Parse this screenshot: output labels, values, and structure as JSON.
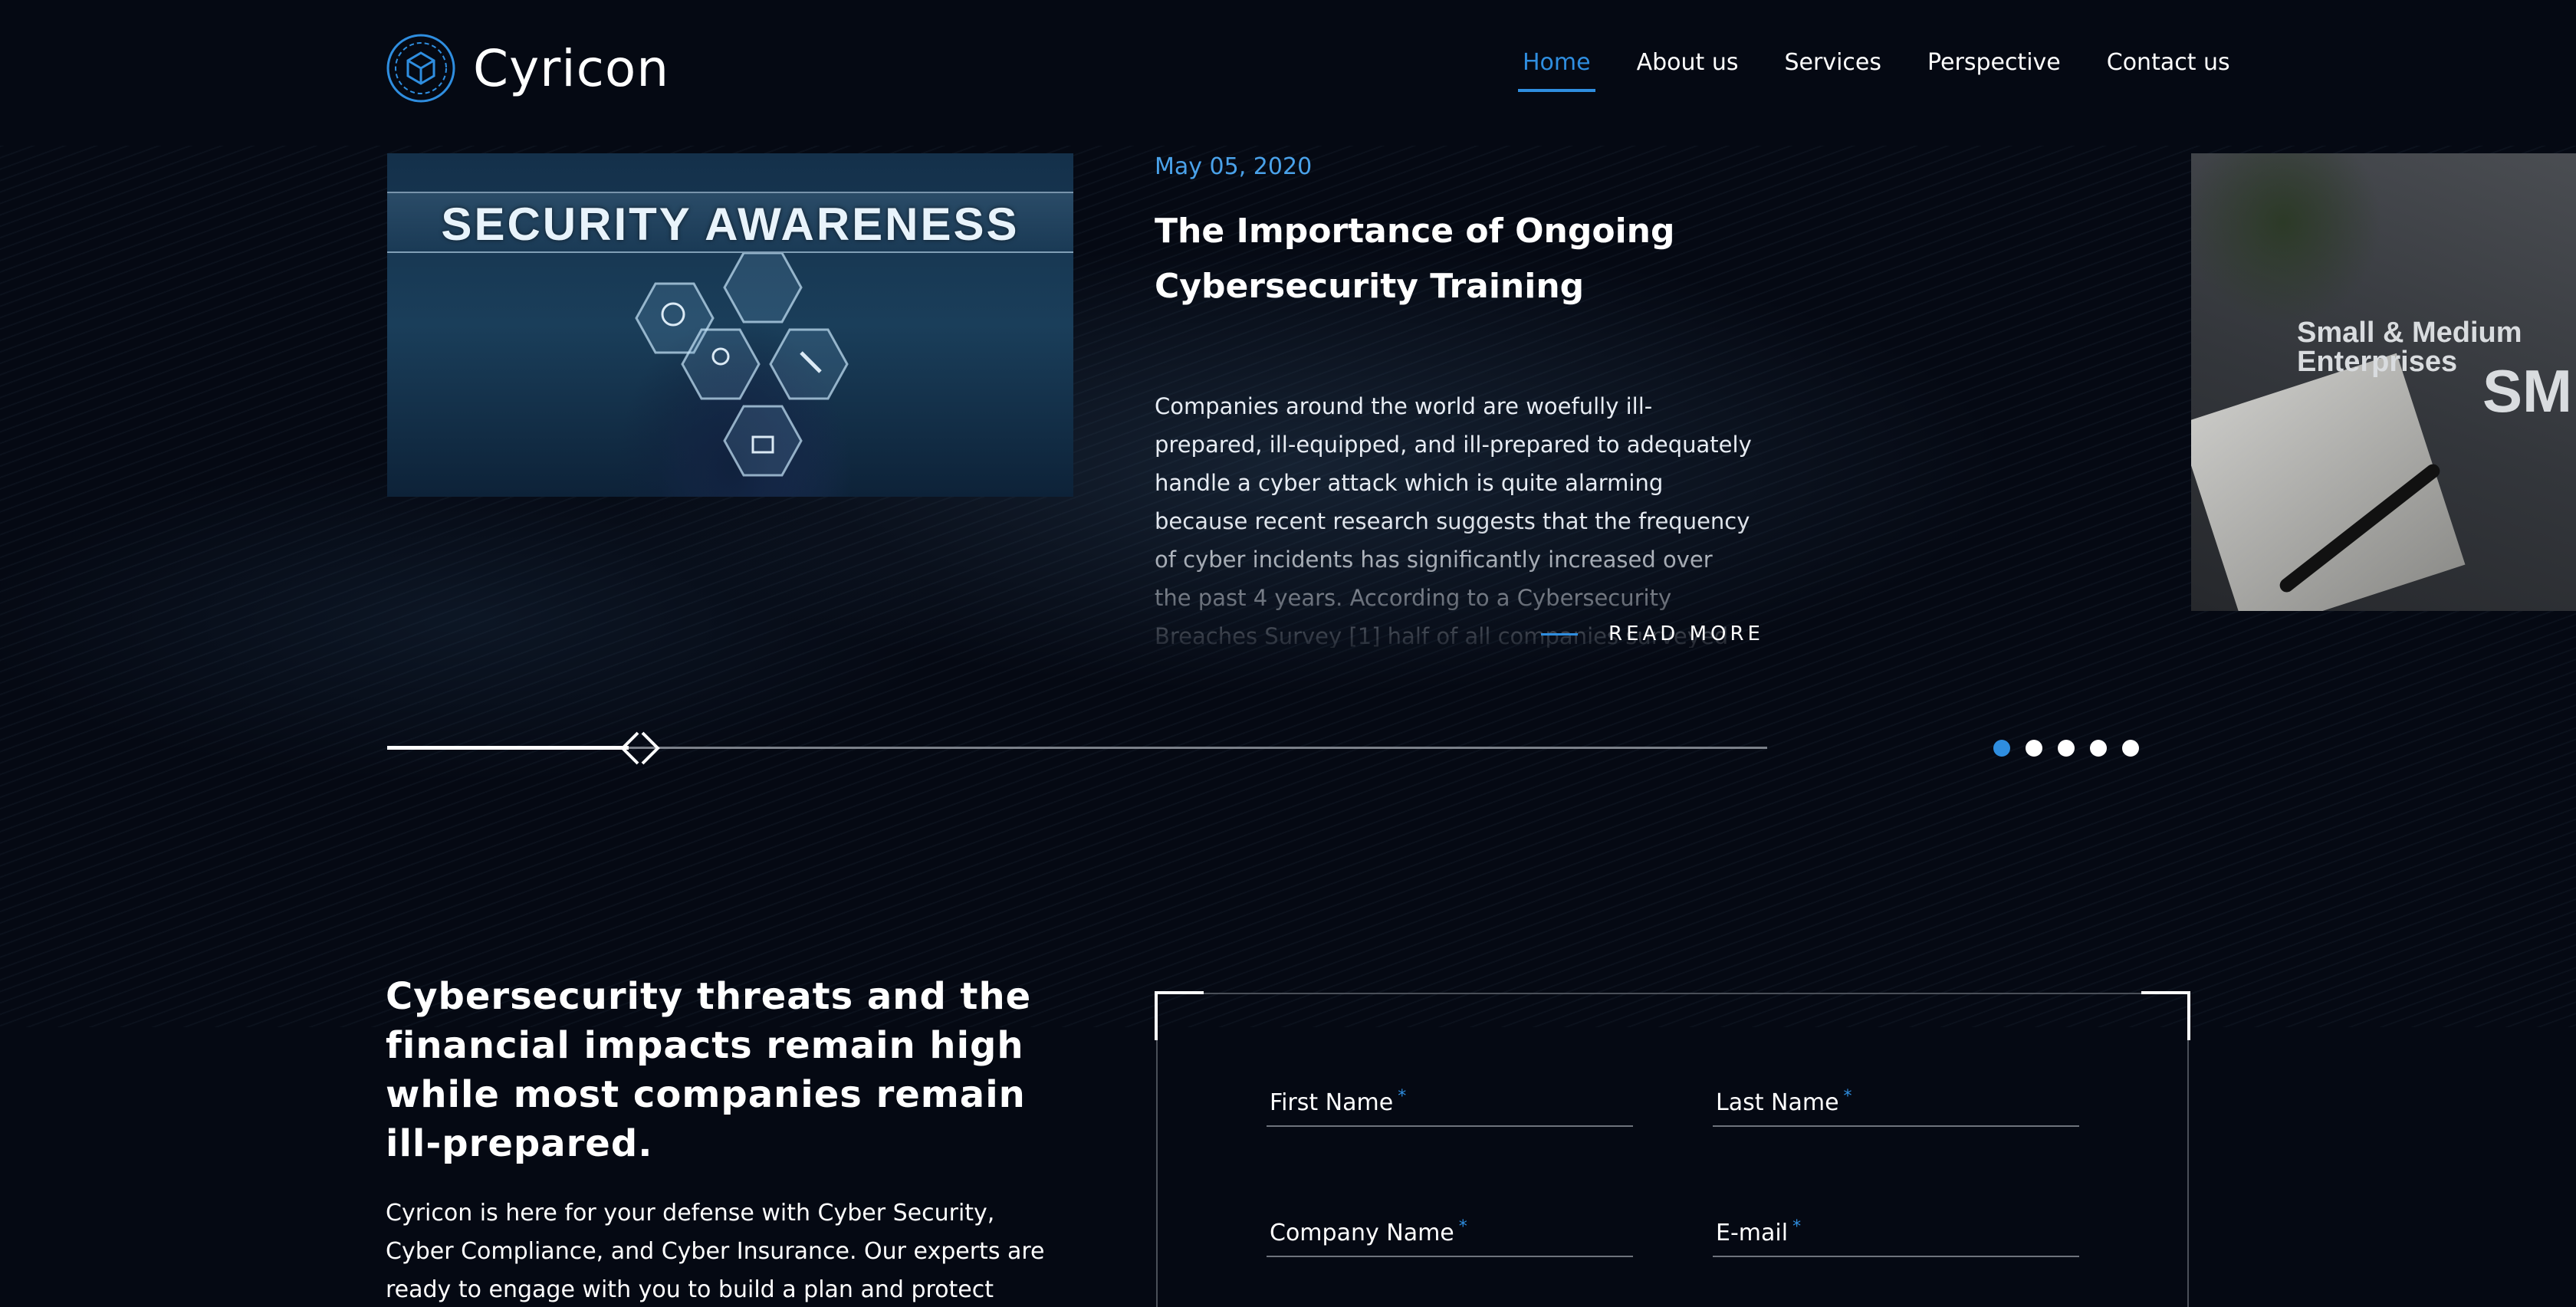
{
  "brand": {
    "name": "Cyricon"
  },
  "nav": {
    "items": [
      {
        "label": "Home",
        "active": true
      },
      {
        "label": "About us"
      },
      {
        "label": "Services"
      },
      {
        "label": "Perspective"
      },
      {
        "label": "Contact us"
      }
    ]
  },
  "slider": {
    "current": {
      "image_text": "SECURITY AWARENESS",
      "date": "May 05, 2020",
      "title": "The Importance of Ongoing Cybersecurity Training",
      "excerpt": "Companies around the world are woefully ill-prepared, ill-equipped, and ill-prepared to adequately handle a cyber attack which is quite alarming because recent research suggests that the frequency of cyber incidents has significantly increased over the past 4 years. According to a Cybersecurity Breaches Survey [1] half of all companies surveyed reported ei",
      "read_more": "READ MORE"
    },
    "next": {
      "image_text": "Small & Medium Enterprises",
      "image_text_large": "SM"
    },
    "dots": {
      "count": 5,
      "active_index": 0
    },
    "progress": 0.18
  },
  "section": {
    "headline": "Cybersecurity threats and the financial impacts remain high while most companies remain ill-prepared.",
    "intro": "Cyricon is here for your defense with Cyber Security, Cyber Compliance, and Cyber Insurance. Our experts are ready to engage with you to build a plan and protect your company"
  },
  "form": {
    "fields": {
      "first_name": "First Name",
      "last_name": "Last Name",
      "company_name": "Company Name",
      "email": "E-mail"
    },
    "required_marker": "*"
  },
  "colors": {
    "background": "#050913",
    "accent": "#2f8ee0",
    "date": "#4aa2ea"
  },
  "icons": {
    "logo": "circuit-hex-logo-icon",
    "slider_nav": "left-right-chevron-icon"
  }
}
